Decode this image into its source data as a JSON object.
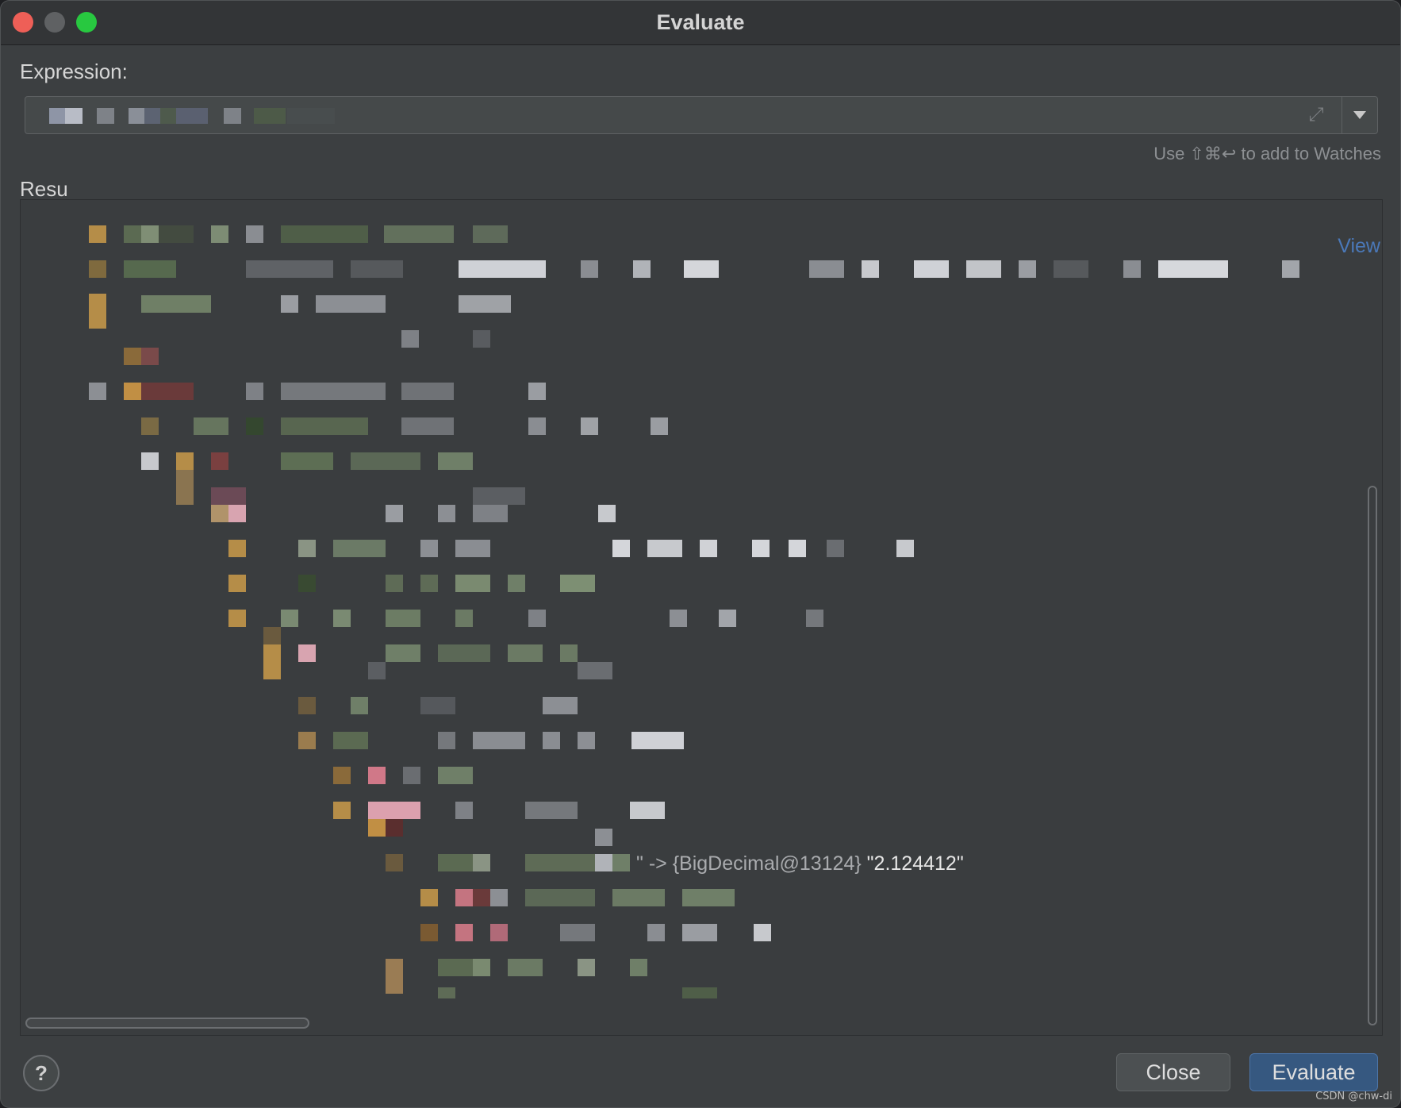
{
  "window": {
    "title": "Evaluate"
  },
  "expression": {
    "label": "Expression:",
    "hint": "Use ⇧⌘↩ to add to Watches"
  },
  "result": {
    "label": "Resu",
    "view_link": "View",
    "value_prefix": "\" -> {BigDecimal@13124} ",
    "value_string": "\"2.124412\""
  },
  "buttons": {
    "help": "?",
    "close": "Close",
    "evaluate": "Evaluate"
  },
  "colors": {
    "accent": "#365880",
    "link": "#4a78b8"
  },
  "watermark": "CSDN @chw-di"
}
